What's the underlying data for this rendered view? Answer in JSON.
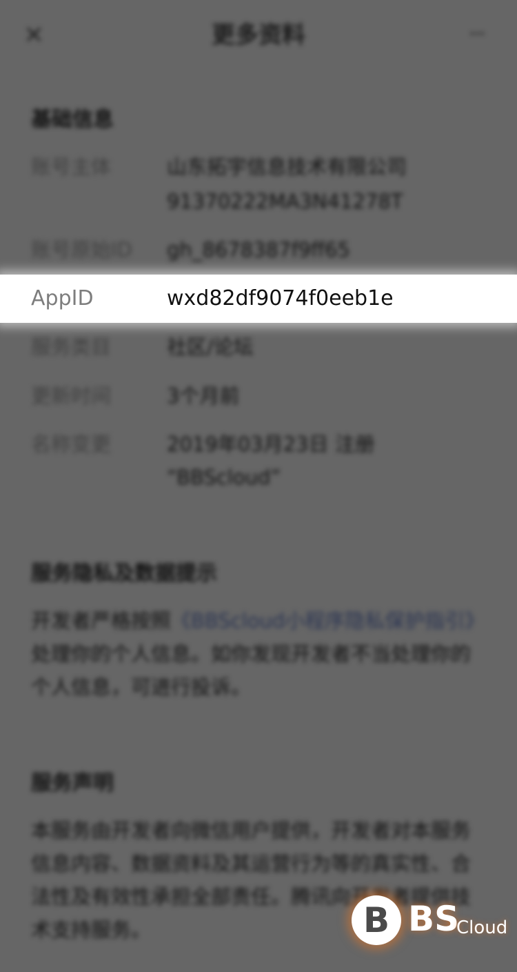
{
  "nav": {
    "title": "更多资料",
    "close_icon": "×",
    "more_icon": "···"
  },
  "basic": {
    "title": "基础信息",
    "rows": [
      {
        "label": "账号主体",
        "lines": [
          "山东拓宇信息技术有限公司",
          "91370222MA3N41278T"
        ]
      },
      {
        "label": "账号原始ID",
        "lines": [
          "gh_8678387f9ff65"
        ]
      },
      {
        "label": "AppID",
        "lines": [
          "wxd82df9074f0eeb1e"
        ]
      },
      {
        "label": "服务类目",
        "lines": [
          "社区/论坛"
        ]
      },
      {
        "label": "更新时间",
        "lines": [
          "3个月前"
        ]
      },
      {
        "label": "名称变更",
        "lines": [
          "2019年03月23日 注册",
          "“BBScloud”"
        ]
      }
    ]
  },
  "privacy": {
    "title": "服务隐私及数据提示",
    "text_before": "开发者严格按照",
    "link_text": "《BBScloud小程序隐私保护指引》",
    "text_after": "处理你的个人信息。如你发现开发者不当处理你的个人信息，可进行投诉。"
  },
  "statement": {
    "title": "服务声明",
    "text": "本服务由开发者向微信用户提供，开发者对本服务信息内容、数据资料及其运营行为等的真实性、合法性及有效性承担全部责任。腾讯向开发者提供技术支持服务。"
  },
  "watermark": {
    "b": "B",
    "bs": "BS",
    "cloud": "Cloud"
  }
}
